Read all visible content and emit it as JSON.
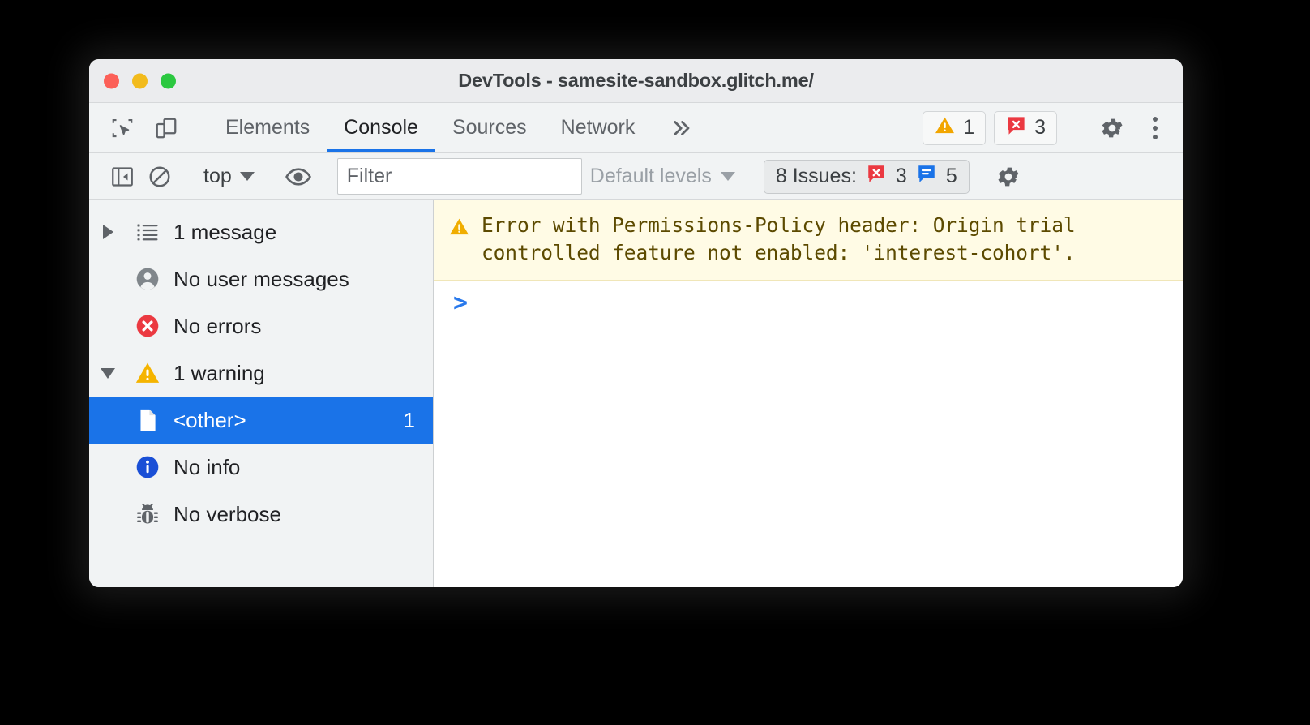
{
  "window": {
    "title": "DevTools - samesite-sandbox.glitch.me/",
    "traffic_lights": {
      "close": "close-window",
      "minimize": "minimize-window",
      "maximize": "maximize-window"
    },
    "colors": {
      "accent": "#1a73e8",
      "warning": "#f2a600",
      "error": "#eb3941",
      "info": "#1a73e8",
      "chrome_bg": "#f1f3f4",
      "warning_msg_bg": "#fffbe5",
      "warning_msg_text": "#5c4a00"
    }
  },
  "toolbar": {
    "inspect_icon": "inspect-element-icon",
    "device_icon": "device-toolbar-icon",
    "tabs": [
      {
        "label": "Elements",
        "active": false
      },
      {
        "label": "Console",
        "active": true
      },
      {
        "label": "Sources",
        "active": false
      },
      {
        "label": "Network",
        "active": false
      }
    ],
    "more_tabs_label": "»",
    "warning_count": "1",
    "error_count": "3",
    "warning_icon": "warning-triangle-icon",
    "error_icon": "error-bubble-icon",
    "settings_icon": "gear-icon",
    "menu_icon": "kebab-menu-icon"
  },
  "filterbar": {
    "sidebar_toggle_icon": "console-sidebar-toggle-icon",
    "clear_icon": "clear-console-icon",
    "context_label": "top",
    "context_caret_icon": "chevron-down-icon",
    "eye_icon": "live-expression-eye-icon",
    "filter_placeholder": "Filter",
    "filter_value": "",
    "levels_label": "Default levels",
    "levels_caret_icon": "chevron-down-icon",
    "issues_label": "8 Issues:",
    "issues_error_icon": "error-bubble-icon",
    "issues_error_count": "3",
    "issues_info_icon": "info-bubble-icon",
    "issues_info_count": "5",
    "settings_icon": "gear-icon"
  },
  "sidebar": {
    "items": [
      {
        "label": "1 message",
        "icon": "list-icon",
        "twisty": "collapsed",
        "count": "",
        "selected": false,
        "child": false
      },
      {
        "label": "No user messages",
        "icon": "user-icon",
        "twisty": "none",
        "count": "",
        "selected": false,
        "child": false
      },
      {
        "label": "No errors",
        "icon": "error-circle-icon",
        "twisty": "none",
        "count": "",
        "selected": false,
        "child": false
      },
      {
        "label": "1 warning",
        "icon": "warning-triangle-icon",
        "twisty": "expanded",
        "count": "",
        "selected": false,
        "child": false
      },
      {
        "label": "<other>",
        "icon": "file-icon",
        "twisty": "none",
        "count": "1",
        "selected": true,
        "child": true
      },
      {
        "label": "No info",
        "icon": "info-circle-icon",
        "twisty": "none",
        "count": "",
        "selected": false,
        "child": false
      },
      {
        "label": "No verbose",
        "icon": "bug-icon",
        "twisty": "none",
        "count": "",
        "selected": false,
        "child": false
      }
    ]
  },
  "console": {
    "messages": [
      {
        "level": "warning",
        "icon": "warning-triangle-icon",
        "text": "Error with Permissions-Policy header: Origin trial\ncontrolled feature not enabled: 'interest-cohort'."
      }
    ],
    "prompt_symbol": ">"
  }
}
